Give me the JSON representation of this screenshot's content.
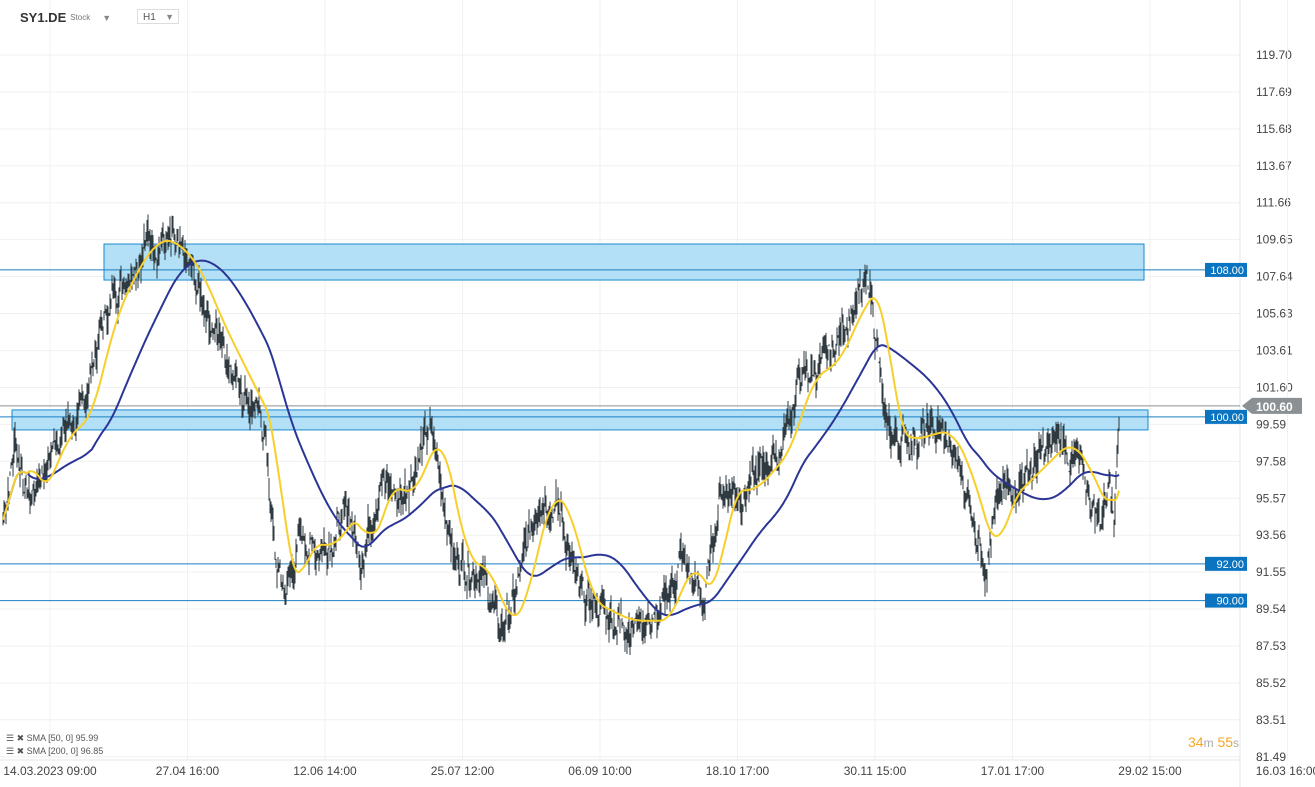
{
  "header": {
    "symbol": "SY1.DE",
    "instrument_type": "Stock",
    "timeframe": "H1"
  },
  "indicators": [
    {
      "label": "SMA [50, 0] 95.99",
      "color": "#f7cf2a"
    },
    {
      "label": "SMA [200, 0] 96.85",
      "color": "#2b3595"
    }
  ],
  "timer": {
    "minutes": "34",
    "m": "m",
    "seconds": "55",
    "s": "s"
  },
  "chart_data": {
    "type": "line",
    "title": "SY1.DE H1",
    "ylim": [
      81.49,
      120.7
    ],
    "y_ticks": [
      "119.70",
      "117.69",
      "115.68",
      "113.67",
      "111.66",
      "109.65",
      "107.64",
      "105.63",
      "103.61",
      "101.60",
      "99.59",
      "97.58",
      "95.57",
      "93.56",
      "91.55",
      "89.54",
      "87.53",
      "85.52",
      "83.51",
      "81.49"
    ],
    "x_ticks": [
      "14.03.2023  09:00",
      "27.04  16:00",
      "12.06  14:00",
      "25.07  12:00",
      "06.09  10:00",
      "18.10  17:00",
      "30.11  15:00",
      "17.01  17:00",
      "29.02  15:00",
      "16.03  16:00"
    ],
    "price_keypoints": [
      [
        0,
        94.4
      ],
      [
        12,
        98.7
      ],
      [
        27,
        95.5
      ],
      [
        57,
        99.3
      ],
      [
        77,
        99.8
      ],
      [
        97,
        104.7
      ],
      [
        117,
        107.4
      ],
      [
        142,
        109.6
      ],
      [
        162,
        109.6
      ],
      [
        187,
        108.0
      ],
      [
        207,
        105.3
      ],
      [
        237,
        102.0
      ],
      [
        262,
        99.3
      ],
      [
        272,
        92.2
      ],
      [
        282,
        90.3
      ],
      [
        297,
        93.3
      ],
      [
        317,
        92.8
      ],
      [
        347,
        94.9
      ],
      [
        357,
        92.2
      ],
      [
        377,
        96.6
      ],
      [
        397,
        95.5
      ],
      [
        427,
        99.3
      ],
      [
        437,
        96.6
      ],
      [
        452,
        92.2
      ],
      [
        477,
        91.7
      ],
      [
        497,
        88.4
      ],
      [
        512,
        90.0
      ],
      [
        537,
        96.0
      ],
      [
        557,
        94.9
      ],
      [
        577,
        90.0
      ],
      [
        617,
        88.9
      ],
      [
        657,
        88.9
      ],
      [
        677,
        92.2
      ],
      [
        702,
        90.0
      ],
      [
        717,
        96.0
      ],
      [
        742,
        96.0
      ],
      [
        777,
        98.2
      ],
      [
        797,
        102.0
      ],
      [
        827,
        103.1
      ],
      [
        847,
        105.8
      ],
      [
        867,
        107.2
      ],
      [
        875,
        103.6
      ],
      [
        882,
        99.3
      ],
      [
        897,
        98.7
      ],
      [
        937,
        99.3
      ],
      [
        957,
        97.1
      ],
      [
        982,
        92.2
      ],
      [
        997,
        95.5
      ],
      [
        1027,
        97.1
      ],
      [
        1057,
        98.7
      ],
      [
        1077,
        97.1
      ],
      [
        1097,
        94.4
      ],
      [
        1107,
        96.6
      ],
      [
        1112,
        95.5
      ],
      [
        1116,
        100.6
      ]
    ],
    "zones": [
      {
        "from": 107.45,
        "to": 109.41,
        "start": 101,
        "end": 1141
      },
      {
        "from": 99.29,
        "to": 100.38,
        "start": 9,
        "end": 1145
      }
    ],
    "levels": [
      {
        "value": 108.0,
        "label": "108.00"
      },
      {
        "value": 100.0,
        "label": "100.00"
      },
      {
        "value": 92.0,
        "label": "92.00"
      },
      {
        "value": 90.0,
        "label": "90.00"
      }
    ],
    "current_price": {
      "value": 100.6,
      "label": "100.60"
    },
    "sma_short": {
      "period": 50,
      "last": 95.99,
      "color": "#f7cf2a"
    },
    "sma_long": {
      "period": 200,
      "last": 96.85,
      "color": "#2b3595"
    }
  }
}
